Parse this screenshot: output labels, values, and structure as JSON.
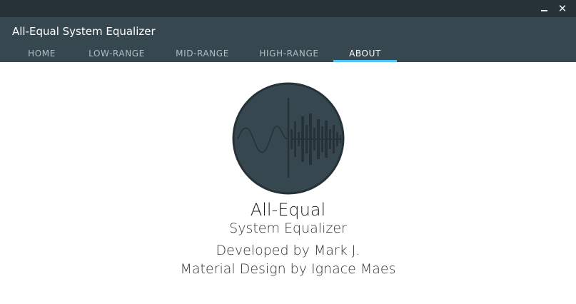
{
  "window": {
    "minimize_symbol": "",
    "close_symbol": "✕"
  },
  "header": {
    "title": "All-Equal System Equalizer",
    "tabs": [
      {
        "label": "HOME",
        "active": false
      },
      {
        "label": "LOW-RANGE",
        "active": false
      },
      {
        "label": "MID-RANGE",
        "active": false
      },
      {
        "label": "HIGH-RANGE",
        "active": false
      },
      {
        "label": "ABOUT",
        "active": true
      }
    ]
  },
  "about": {
    "logo_icon": "waveform-logo-icon",
    "app_name": "All-Equal",
    "app_subtitle": "System Equalizer",
    "developer": "Developed by Mark J.",
    "design_credit": "Material Design by Ignace Maes"
  },
  "colors": {
    "titlebar": "#263238",
    "appbar": "#37474f",
    "accent": "#4fc3f7",
    "logo_circle": "#37474f",
    "logo_wave": "#263238"
  }
}
